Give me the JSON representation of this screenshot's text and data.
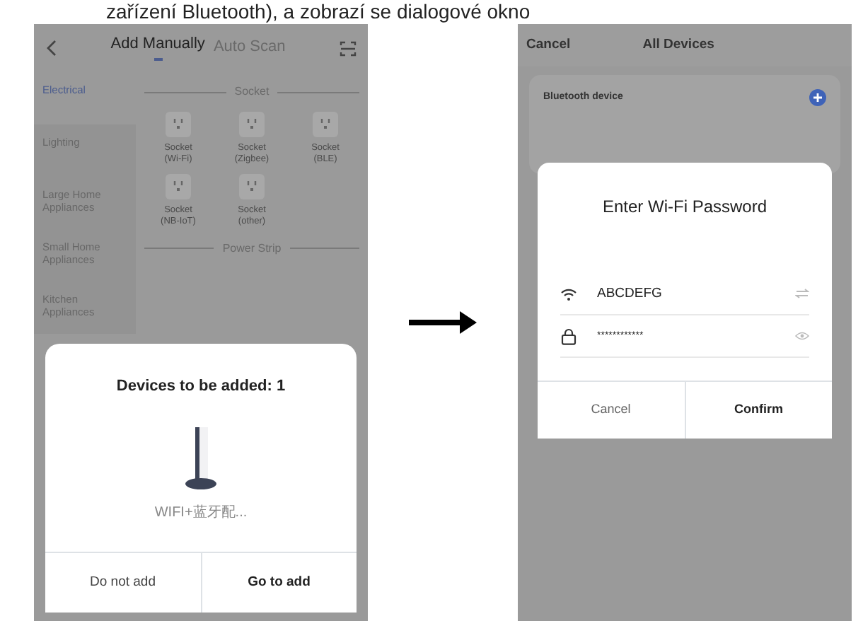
{
  "caption": "zařízení Bluetooth), a zobrazí se dialogové okno",
  "left_screen": {
    "tabs": [
      {
        "label": "Add Manually",
        "selected": true
      },
      {
        "label": "Auto Scan",
        "selected": false
      }
    ],
    "sidebar": [
      {
        "label": "Electrical",
        "selected": true
      },
      {
        "label": "Lighting",
        "selected": false
      },
      {
        "label": "Large Home Appliances",
        "selected": false
      },
      {
        "label": "Small Home Appliances",
        "selected": false
      },
      {
        "label": "Kitchen Appliances",
        "selected": false
      }
    ],
    "sections": [
      {
        "title": "Socket",
        "devices": [
          {
            "label": "Socket (Wi-Fi)"
          },
          {
            "label": "Socket (Zigbee)"
          },
          {
            "label": "Socket (BLE)"
          },
          {
            "label": "Socket (NB-IoT)"
          },
          {
            "label": "Socket (other)"
          }
        ]
      },
      {
        "title": "Power Strip"
      }
    ],
    "sheet": {
      "title": "Devices to be added: 1",
      "device_name": "WIFI+蓝牙配...",
      "buttons": [
        {
          "label": "Do not add",
          "kind": "secondary"
        },
        {
          "label": "Go to add",
          "kind": "primary"
        }
      ]
    }
  },
  "right_screen": {
    "cancel": "Cancel",
    "title": "All Devices",
    "card_title": "Bluetooth device",
    "dialog": {
      "title": "Enter Wi-Fi Password",
      "fields": [
        {
          "kind": "ssid",
          "value": "ABCDEFG"
        },
        {
          "kind": "password",
          "value": "************"
        }
      ],
      "buttons": [
        {
          "label": "Cancel",
          "kind": "secondary"
        },
        {
          "label": "Confirm",
          "kind": "primary"
        }
      ]
    }
  }
}
